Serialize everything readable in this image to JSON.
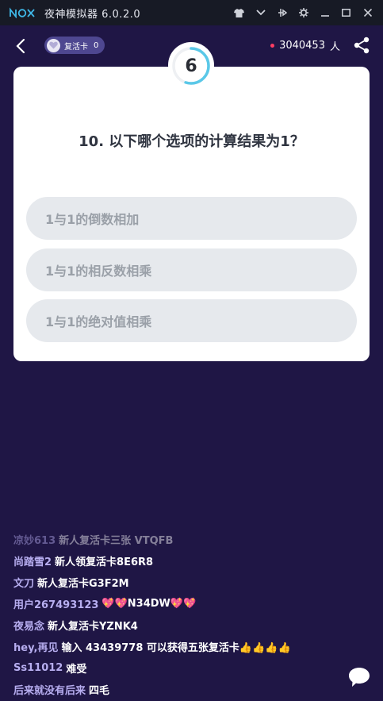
{
  "titlebar": {
    "title": "夜神模拟器 6.0.2.0"
  },
  "header": {
    "revive_label": "复活卡",
    "revive_count": "0",
    "online_count": "3040453",
    "online_unit": "人"
  },
  "timer": {
    "seconds": "6",
    "progress": 0.55
  },
  "question": {
    "text": "10. 以下哪个选项的计算结果为1？",
    "options": [
      "1与1的倒数相加",
      "1与1的相反数相乘",
      "1与1的绝对值相乘"
    ]
  },
  "chat": [
    {
      "user": "凉妙613",
      "text": "新人复活卡三张 VTQFB"
    },
    {
      "user": "尚踏雪2",
      "text": "新人领复活卡8E6R8"
    },
    {
      "user": "文刀",
      "text": "新人复活卡G3F2M"
    },
    {
      "user": "用户267493123",
      "text": "💖💖N34DW💖💖"
    },
    {
      "user": "夜易念",
      "text": "新人复活卡YZNK4"
    },
    {
      "user": "hey,再见",
      "text": "输入 43439778 可以获得五张复活卡👍👍👍👍"
    },
    {
      "user": "Ss11012",
      "text": "难受"
    },
    {
      "user": "后来就没有后来",
      "text": "四毛"
    }
  ],
  "colors": {
    "background": "#1f1645",
    "timer_accent": "#5ac8e8",
    "online_dot": "#ff3d63"
  },
  "icons": {
    "back": "chevron-left-icon",
    "revive": "heart-icon",
    "share": "share-icon",
    "chat": "speech-bubble-icon"
  }
}
